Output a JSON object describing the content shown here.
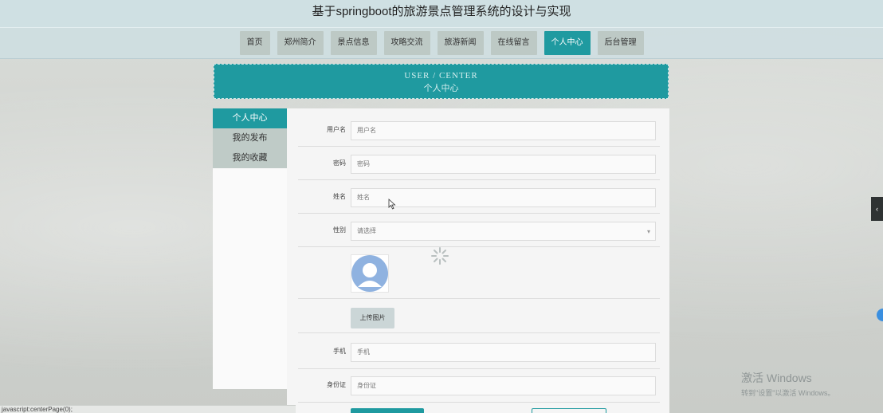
{
  "app": {
    "title": "基于springboot的旅游景点管理系统的设计与实现"
  },
  "nav": {
    "items": [
      {
        "label": "首页"
      },
      {
        "label": "郑州简介"
      },
      {
        "label": "景点信息"
      },
      {
        "label": "攻略交流"
      },
      {
        "label": "旅游新闻"
      },
      {
        "label": "在线留言"
      },
      {
        "label": "个人中心"
      },
      {
        "label": "后台管理"
      }
    ],
    "active": "个人中心"
  },
  "banner": {
    "title_en": "USER / CENTER",
    "title_cn": "个人中心"
  },
  "sidebar": {
    "items": [
      {
        "label": "个人中心"
      },
      {
        "label": "我的发布"
      },
      {
        "label": "我的收藏"
      }
    ]
  },
  "form": {
    "username": {
      "label": "用户名",
      "placeholder": "用户名"
    },
    "password": {
      "label": "密码",
      "placeholder": "密码"
    },
    "name": {
      "label": "姓名",
      "placeholder": "姓名"
    },
    "gender": {
      "label": "性别",
      "value": "请选择"
    },
    "upload_label": "上传图片",
    "phone": {
      "label": "手机",
      "placeholder": "手机"
    },
    "idcard": {
      "label": "身份证",
      "placeholder": "身份证"
    }
  },
  "watermark": {
    "title": "激活 Windows",
    "subtitle": "转到\"设置\"以激活 Windows。"
  },
  "status": {
    "text": "javascript:centerPage(0);"
  },
  "colors": {
    "accent": "#1f9aa0",
    "nav_bg": "#bdc9c5",
    "title_bg": "#cfe0e3"
  },
  "icons": {
    "avatar": "user-avatar-icon",
    "spinner": "loading-spinner-icon",
    "cursor": "mouse-cursor-icon",
    "panel_toggle": "chevron-left-icon"
  }
}
